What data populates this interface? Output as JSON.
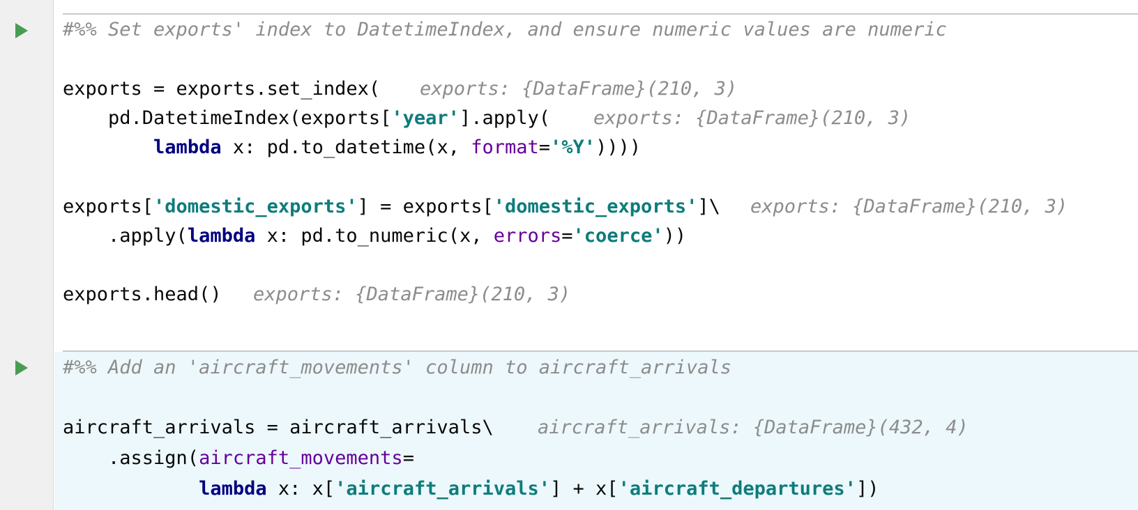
{
  "cells": [
    {
      "run_label": "Run cell",
      "comment": "#%% Set exports' index to DatetimeIndex, and ensure numeric values are numeric",
      "lines": {
        "l1_code": "exports = exports.set_index(",
        "l1_hint": "exports: {DataFrame}(210, 3)",
        "l2_a": "    pd.DatetimeIndex(exports[",
        "l2_str": "'year'",
        "l2_b": "].apply(",
        "l2_hint": "exports: {DataFrame}(210, 3)",
        "l3_indent": "        ",
        "l3_kw": "lambda",
        "l3_a": " x: pd.to_datetime(x, ",
        "l3_kwarg": "format",
        "l3_eq": "=",
        "l3_str": "'%Y'",
        "l3_b": "))))",
        "l5_a": "exports[",
        "l5_str1": "'domestic_exports'",
        "l5_b": "] = exports[",
        "l5_str2": "'domestic_exports'",
        "l5_c": "]\\",
        "l5_hint": "exports: {DataFrame}(210, 3)",
        "l6_a": "    .apply(",
        "l6_kw": "lambda",
        "l6_b": " x: pd.to_numeric(x, ",
        "l6_kwarg": "errors",
        "l6_eq": "=",
        "l6_str": "'coerce'",
        "l6_c": "))",
        "l8_code": "exports.head()",
        "l8_hint": "exports: {DataFrame}(210, 3)"
      }
    },
    {
      "run_label": "Run cell",
      "comment": "#%% Add an 'aircraft_movements' column to aircraft_arrivals",
      "lines": {
        "l1_code": "aircraft_arrivals = aircraft_arrivals\\",
        "l1_hint": "aircraft_arrivals: {DataFrame}(432, 4)",
        "l2_a": "    .assign(",
        "l2_kwarg": "aircraft_movements",
        "l2_eq": "=",
        "l3_indent": "            ",
        "l3_kw": "lambda",
        "l3_a": " x: x[",
        "l3_str1": "'aircraft_arrivals'",
        "l3_b": "] + x[",
        "l3_str2": "'aircraft_departures'",
        "l3_c": "])"
      }
    }
  ],
  "colors": {
    "gutter_bg": "#f0f0f0",
    "active_cell_bg": "#edf8fc",
    "run_icon": "#499c54",
    "comment": "#8c8c8c",
    "string": "#0e7c7b",
    "keyword": "#000080",
    "kwarg": "#660099"
  }
}
